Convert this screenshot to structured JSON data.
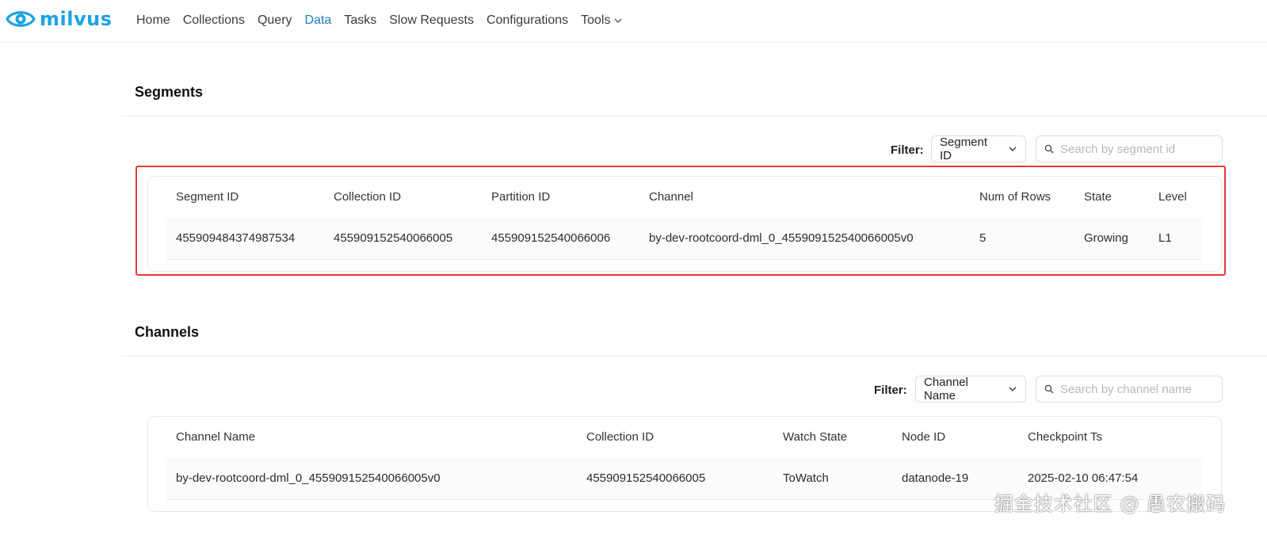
{
  "brand": {
    "name": "milvus",
    "color": "#1aa3e3"
  },
  "nav": {
    "items": [
      "Home",
      "Collections",
      "Query",
      "Data",
      "Tasks",
      "Slow Requests",
      "Configurations"
    ],
    "active": "Data",
    "tools_label": "Tools"
  },
  "segments": {
    "title": "Segments",
    "filter_label": "Filter:",
    "filter_select": "Segment ID",
    "search_placeholder": "Search by segment id",
    "columns": [
      "Segment ID",
      "Collection ID",
      "Partition ID",
      "Channel",
      "Num of Rows",
      "State",
      "Level"
    ],
    "rows": [
      [
        "455909484374987534",
        "455909152540066005",
        "455909152540066006",
        "by-dev-rootcoord-dml_0_455909152540066005v0",
        "5",
        "Growing",
        "L1"
      ]
    ]
  },
  "channels": {
    "title": "Channels",
    "filter_label": "Filter:",
    "filter_select": "Channel Name",
    "search_placeholder": "Search by channel name",
    "columns": [
      "Channel Name",
      "Collection ID",
      "Watch State",
      "Node ID",
      "Checkpoint Ts"
    ],
    "rows": [
      [
        "by-dev-rootcoord-dml_0_455909152540066005v0",
        "455909152540066005",
        "ToWatch",
        "datanode-19",
        "2025-02-10 06:47:54"
      ]
    ]
  },
  "watermark": "掘金技术社区 @ 愚农搬码",
  "colors": {
    "highlight": "#e53935",
    "nav_active": "#1a7fb8"
  }
}
